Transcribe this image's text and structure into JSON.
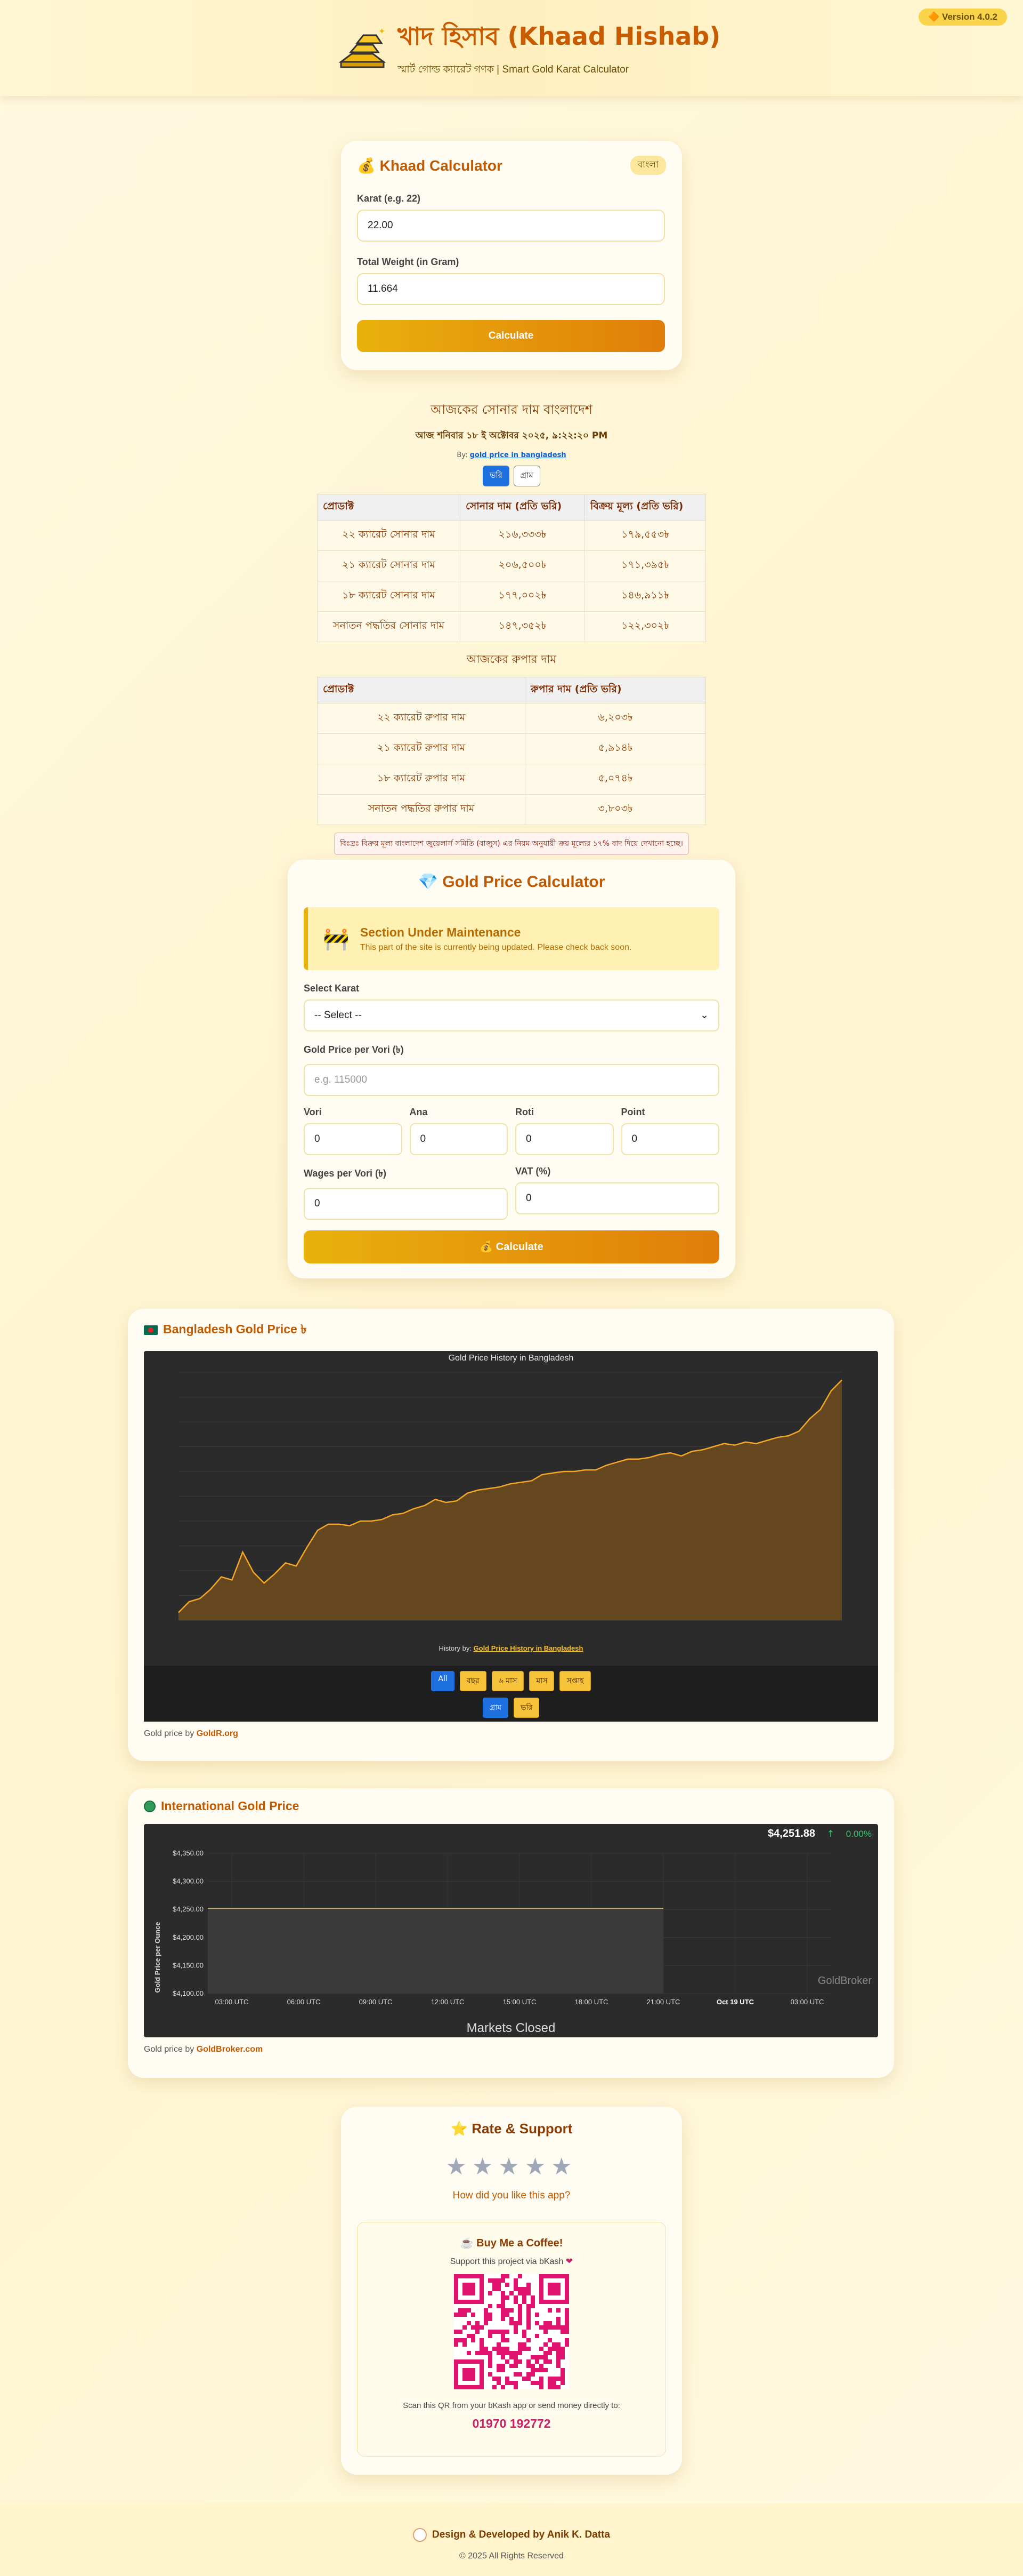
{
  "header": {
    "version": "🔶 Version 4.0.2",
    "title": "খাদ হিসাব (Khaad Hishab)",
    "subtitle": "স্মার্ট গোল্ড ক্যারেট গণক | Smart Gold Karat Calculator"
  },
  "khaad": {
    "title": "Khaad Calculator",
    "lang": "বাংলা",
    "karat_label": "Karat (e.g. 22)",
    "karat_value": "22.00",
    "weight_label": "Total Weight (in Gram)",
    "weight_value": "11.664",
    "button": "Calculate"
  },
  "rates": {
    "title": "আজকের সোনার দাম বাংলাদেশ",
    "date": "আজ শনিবার ১৮ ই অক্টোবর ২০২৫, ৯:২২:২০ PM",
    "by_prefix": "By:",
    "by_link": "gold price in bangladesh",
    "tabs": [
      "ভরি",
      "গ্রাম"
    ],
    "gold_headers": [
      "প্রোডাক্ট",
      "সোনার দাম (প্রতি ভরি)",
      "বিক্রয় মূল্য (প্রতি ভরি)"
    ],
    "gold_rows": [
      [
        "২২ ক্যারেট সোনার দাম",
        "২১৬,৩৩৩৳",
        "১৭৯,৫৫৩৳"
      ],
      [
        "২১ ক্যারেট সোনার দাম",
        "২০৬,৫০০৳",
        "১৭১,৩৯৫৳"
      ],
      [
        "১৮ ক্যারেট সোনার দাম",
        "১৭৭,০০২৳",
        "১৪৬,৯১১৳"
      ],
      [
        "সনাতন পদ্ধতির সোনার দাম",
        "১৪৭,৩৫২৳",
        "১২২,৩০২৳"
      ]
    ],
    "silver_title": "আজকের রুপার দাম",
    "silver_headers": [
      "প্রোডাক্ট",
      "রুপার দাম (প্রতি ভরি)"
    ],
    "silver_rows": [
      [
        "২২ ক্যারেট রুপার দাম",
        "৬,২০৩৳"
      ],
      [
        "২১ ক্যারেট রুপার দাম",
        "৫,৯১৪৳"
      ],
      [
        "১৮ ক্যারেট রুপার দাম",
        "৫,০৭৪৳"
      ],
      [
        "সনাতন পদ্ধতির রুপার দাম",
        "৩,৮০৩৳"
      ]
    ],
    "note": "বিঃদ্রঃ বিক্রয় মূল্য বাংলাদেশ জুয়েলার্স সমিতি (বাজুস) এর নিয়ম অনুযায়ী ক্রয় মূল্যের ১৭% বাদ দিয়ে দেখানো হচ্ছে।"
  },
  "gpc": {
    "title": "Gold Price Calculator",
    "maint_title": "Section Under Maintenance",
    "maint_text": "This part of the site is currently being updated. Please check back soon.",
    "select_label": "Select Karat",
    "select_value": "-- Select --",
    "price_label": "Gold Price per Vori (৳)",
    "price_placeholder": "e.g. 115000",
    "vori_label": "Vori",
    "ana_label": "Ana",
    "roti_label": "Roti",
    "point_label": "Point",
    "vori": "0",
    "ana": "0",
    "roti": "0",
    "point": "0",
    "wages_label": "Wages per Vori (৳)",
    "vat_label": "VAT (%)",
    "wages": "0",
    "vat": "0",
    "button": "Calculate"
  },
  "bd_chart": {
    "heading": "Bangladesh Gold Price ৳",
    "inner_title": "Gold Price History in Bangladesh",
    "history_prefix": "History by:",
    "history_link": "Gold Price History in Bangladesh",
    "range_buttons": [
      "All",
      "বছর",
      "৬ মাস",
      "মাস",
      "সপ্তাহ"
    ],
    "unit_buttons": [
      "গ্রাম",
      "ভরি"
    ],
    "credit_prefix": "Gold price by",
    "credit_link": "GoldR.org",
    "colors": {
      "line": "#f5a623",
      "fill": "#6b4a1e",
      "bg": "#262626",
      "grid": "#3a3a3a",
      "tick": "#00b050"
    }
  },
  "intl_chart": {
    "heading": "International Gold Price",
    "price": "$4,251.88",
    "change": "0.00%",
    "ylabel": "Gold Price per Ounce",
    "status": "Markets Closed",
    "brand": "GoldBroker",
    "credit_prefix": "Gold price by",
    "credit_link": "GoldBroker.com",
    "colors": {
      "line": "#c9b37a",
      "fill": "#3a3a3a",
      "bg": "#262626",
      "change": "#2ecc71"
    }
  },
  "chart_data": [
    {
      "type": "area",
      "title": "Gold Price History in Bangladesh",
      "xlabel": "",
      "ylabel": "",
      "series": [
        {
          "values": [
            0.05,
            0.12,
            0.14,
            0.2,
            0.28,
            0.26,
            0.44,
            0.31,
            0.24,
            0.3,
            0.37,
            0.35,
            0.47,
            0.58,
            0.62,
            0.62,
            0.61,
            0.64,
            0.64,
            0.65,
            0.68,
            0.69,
            0.72,
            0.74,
            0.78,
            0.76,
            0.77,
            0.82,
            0.84,
            0.85,
            0.86,
            0.88,
            0.89,
            0.9,
            0.94,
            0.95,
            0.96,
            0.96,
            0.97,
            0.97,
            1.0,
            1.02,
            1.04,
            1.04,
            1.05,
            1.07,
            1.08,
            1.06,
            1.09,
            1.1,
            1.12,
            1.14,
            1.13,
            1.15,
            1.14,
            1.16,
            1.18,
            1.19,
            1.22,
            1.3,
            1.36,
            1.48,
            1.55
          ]
        }
      ]
    },
    {
      "type": "area",
      "title": "",
      "xlabel": "",
      "ylabel": "Gold Price per Ounce",
      "ylim": [
        4100,
        4350
      ],
      "ticks_y": [
        "$4,350.00",
        "$4,300.00",
        "$4,250.00",
        "$4,200.00",
        "$4,150.00",
        "$4,100.00"
      ],
      "ticks_x": [
        "03:00 UTC",
        "06:00 UTC",
        "09:00 UTC",
        "12:00 UTC",
        "15:00 UTC",
        "18:00 UTC",
        "21:00 UTC",
        "Oct 19 UTC",
        "03:00 UTC"
      ],
      "series": [
        {
          "values": [
            4251.88,
            4251.88
          ]
        }
      ]
    }
  ],
  "rate": {
    "title": "Rate & Support",
    "stars": "★★★★★",
    "question": "How did you like this app?",
    "coffee_title": "Buy Me a Coffee!",
    "coffee_sub": "Support this project via bKash",
    "scan": "Scan this QR from your bKash app or send money directly to:",
    "number": "01970 192772"
  },
  "footer": {
    "credit": "Design & Developed by Anik K. Datta",
    "copy": "© 2025 All Rights Reserved"
  }
}
